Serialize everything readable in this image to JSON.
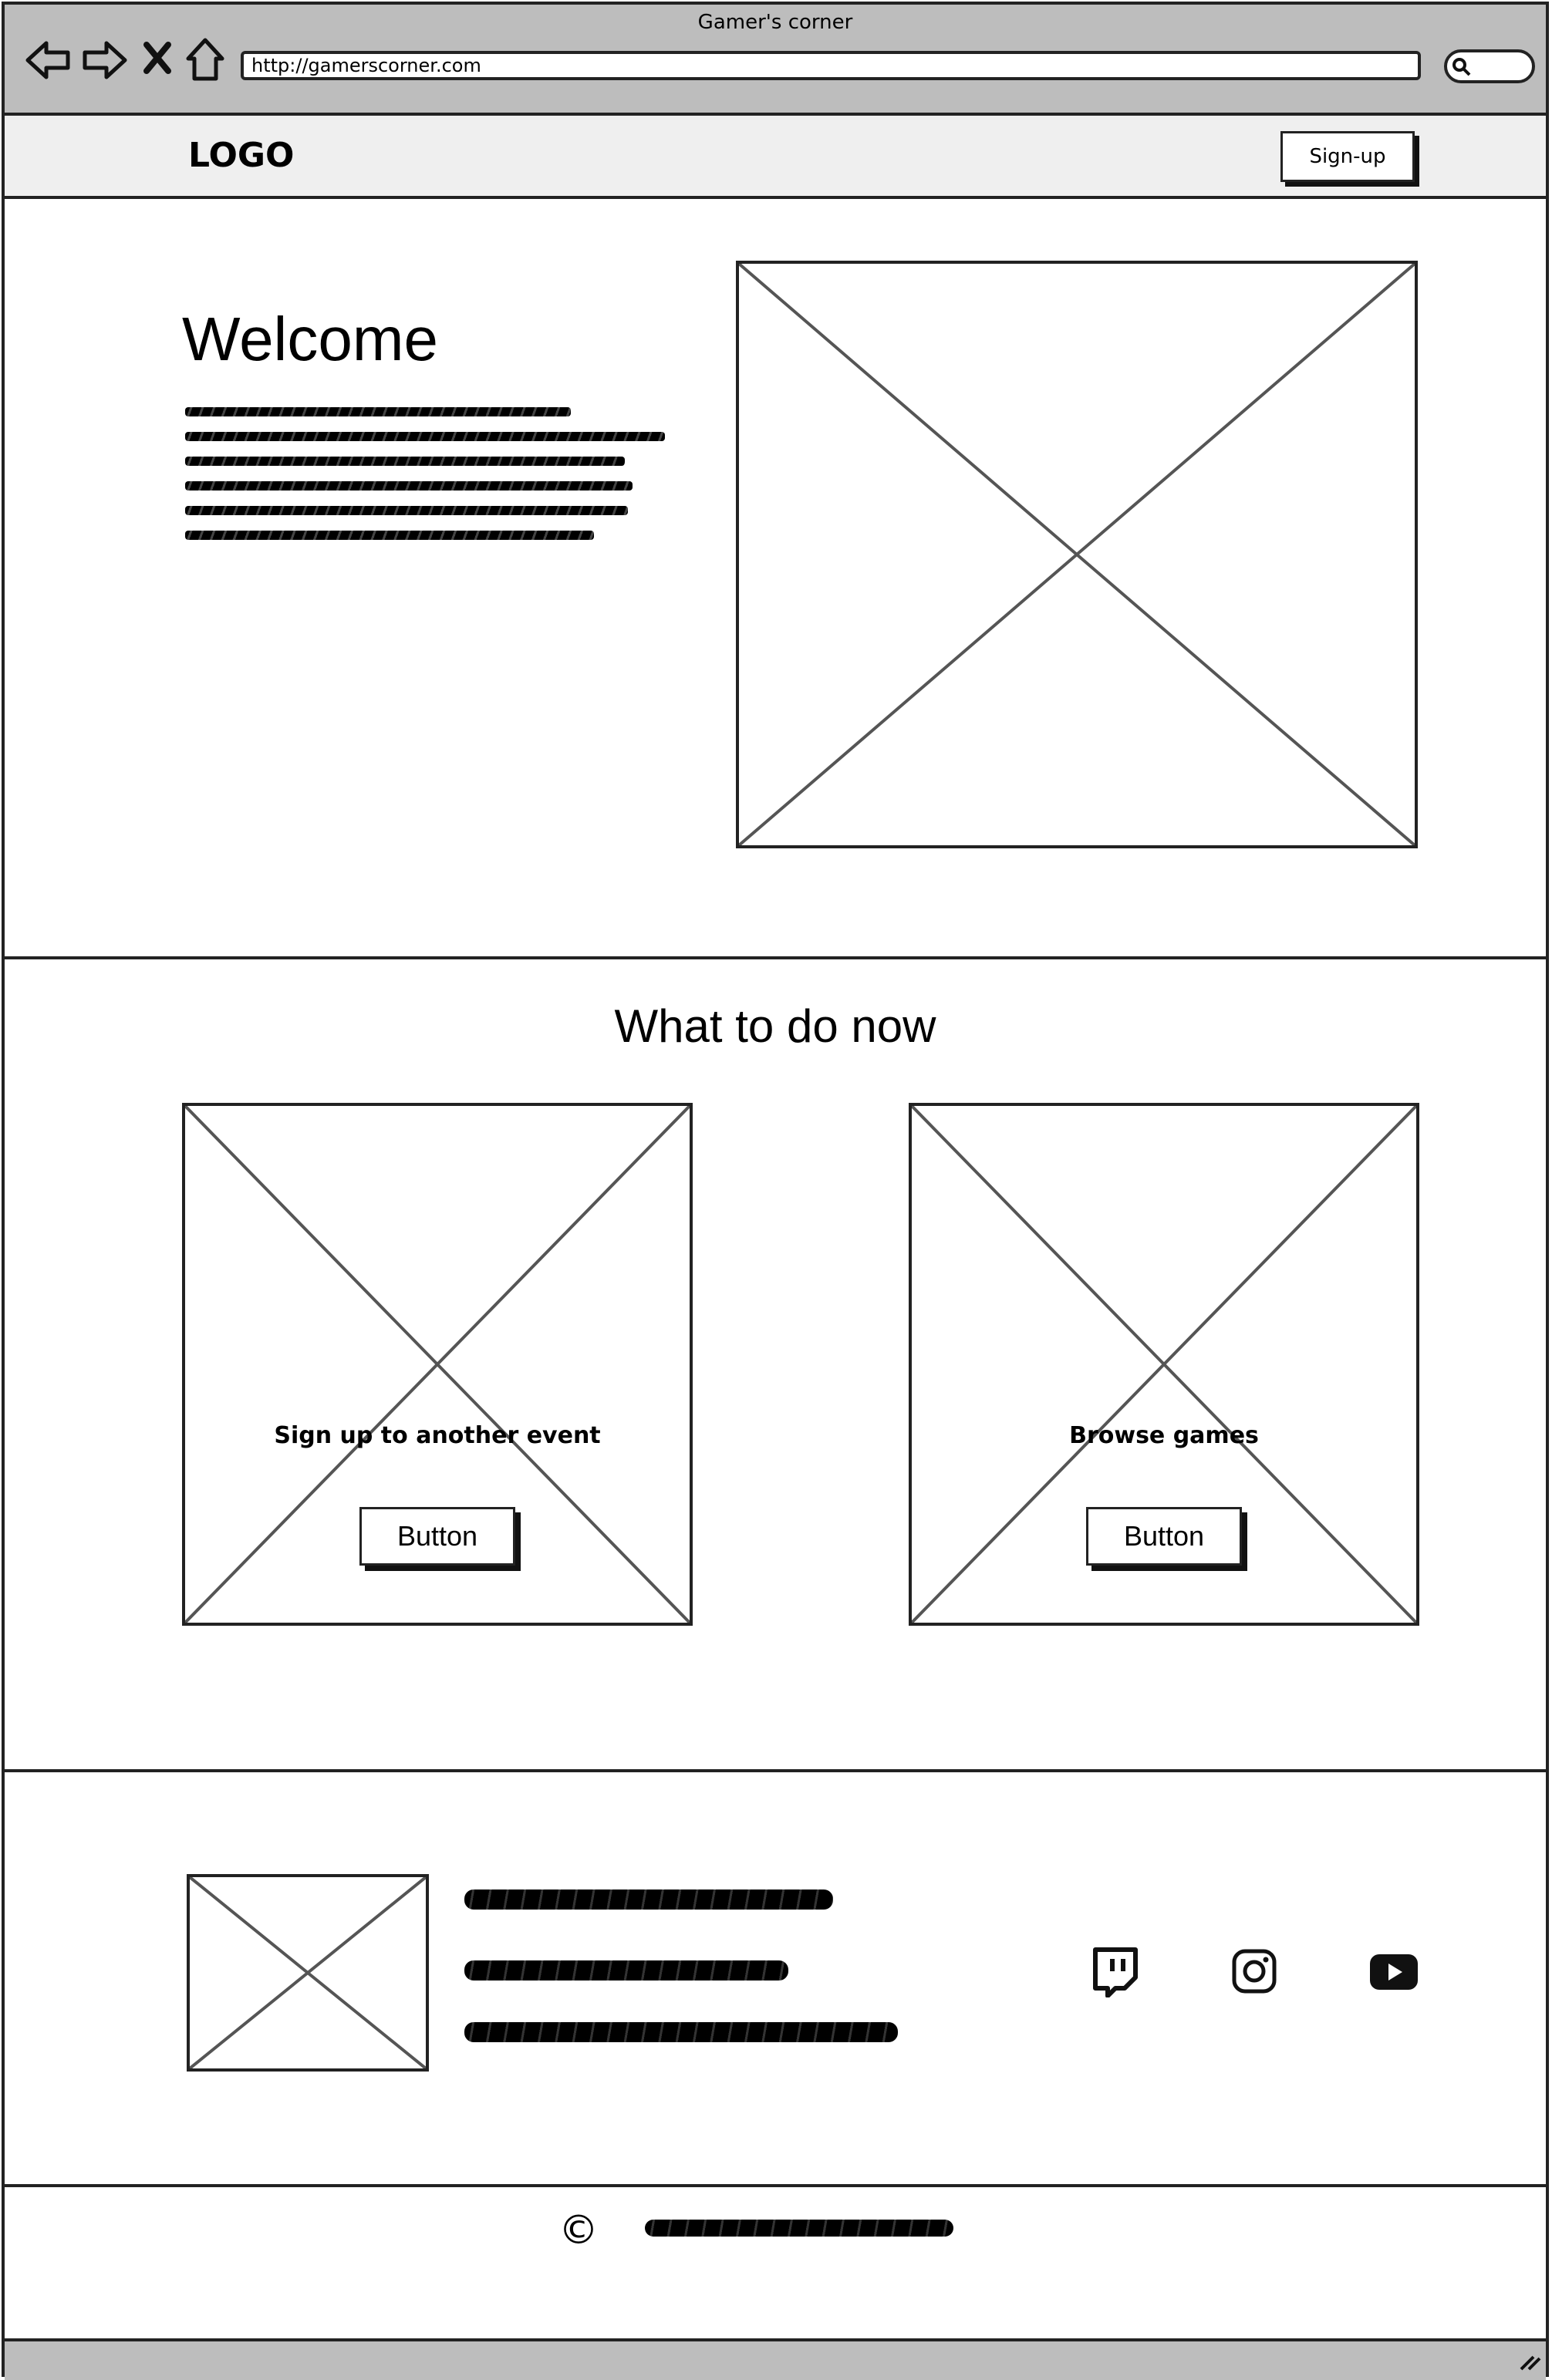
{
  "browser": {
    "window_title": "Gamer's corner",
    "url": "http://gamerscorner.com"
  },
  "header": {
    "logo": "LOGO",
    "signup_label": "Sign-up"
  },
  "hero": {
    "title": "Welcome"
  },
  "actions": {
    "title": "What to do now",
    "cards": [
      {
        "label": "Sign up to another event",
        "button": "Button"
      },
      {
        "label": "Browse games",
        "button": "Button"
      }
    ]
  },
  "footer": {
    "social_icons": [
      "twitch-icon",
      "instagram-icon",
      "youtube-icon"
    ],
    "copyright_symbol": "©"
  },
  "colors": {
    "chrome": "#bdbdbd",
    "header_bg": "#efefef",
    "ink": "#222222"
  }
}
